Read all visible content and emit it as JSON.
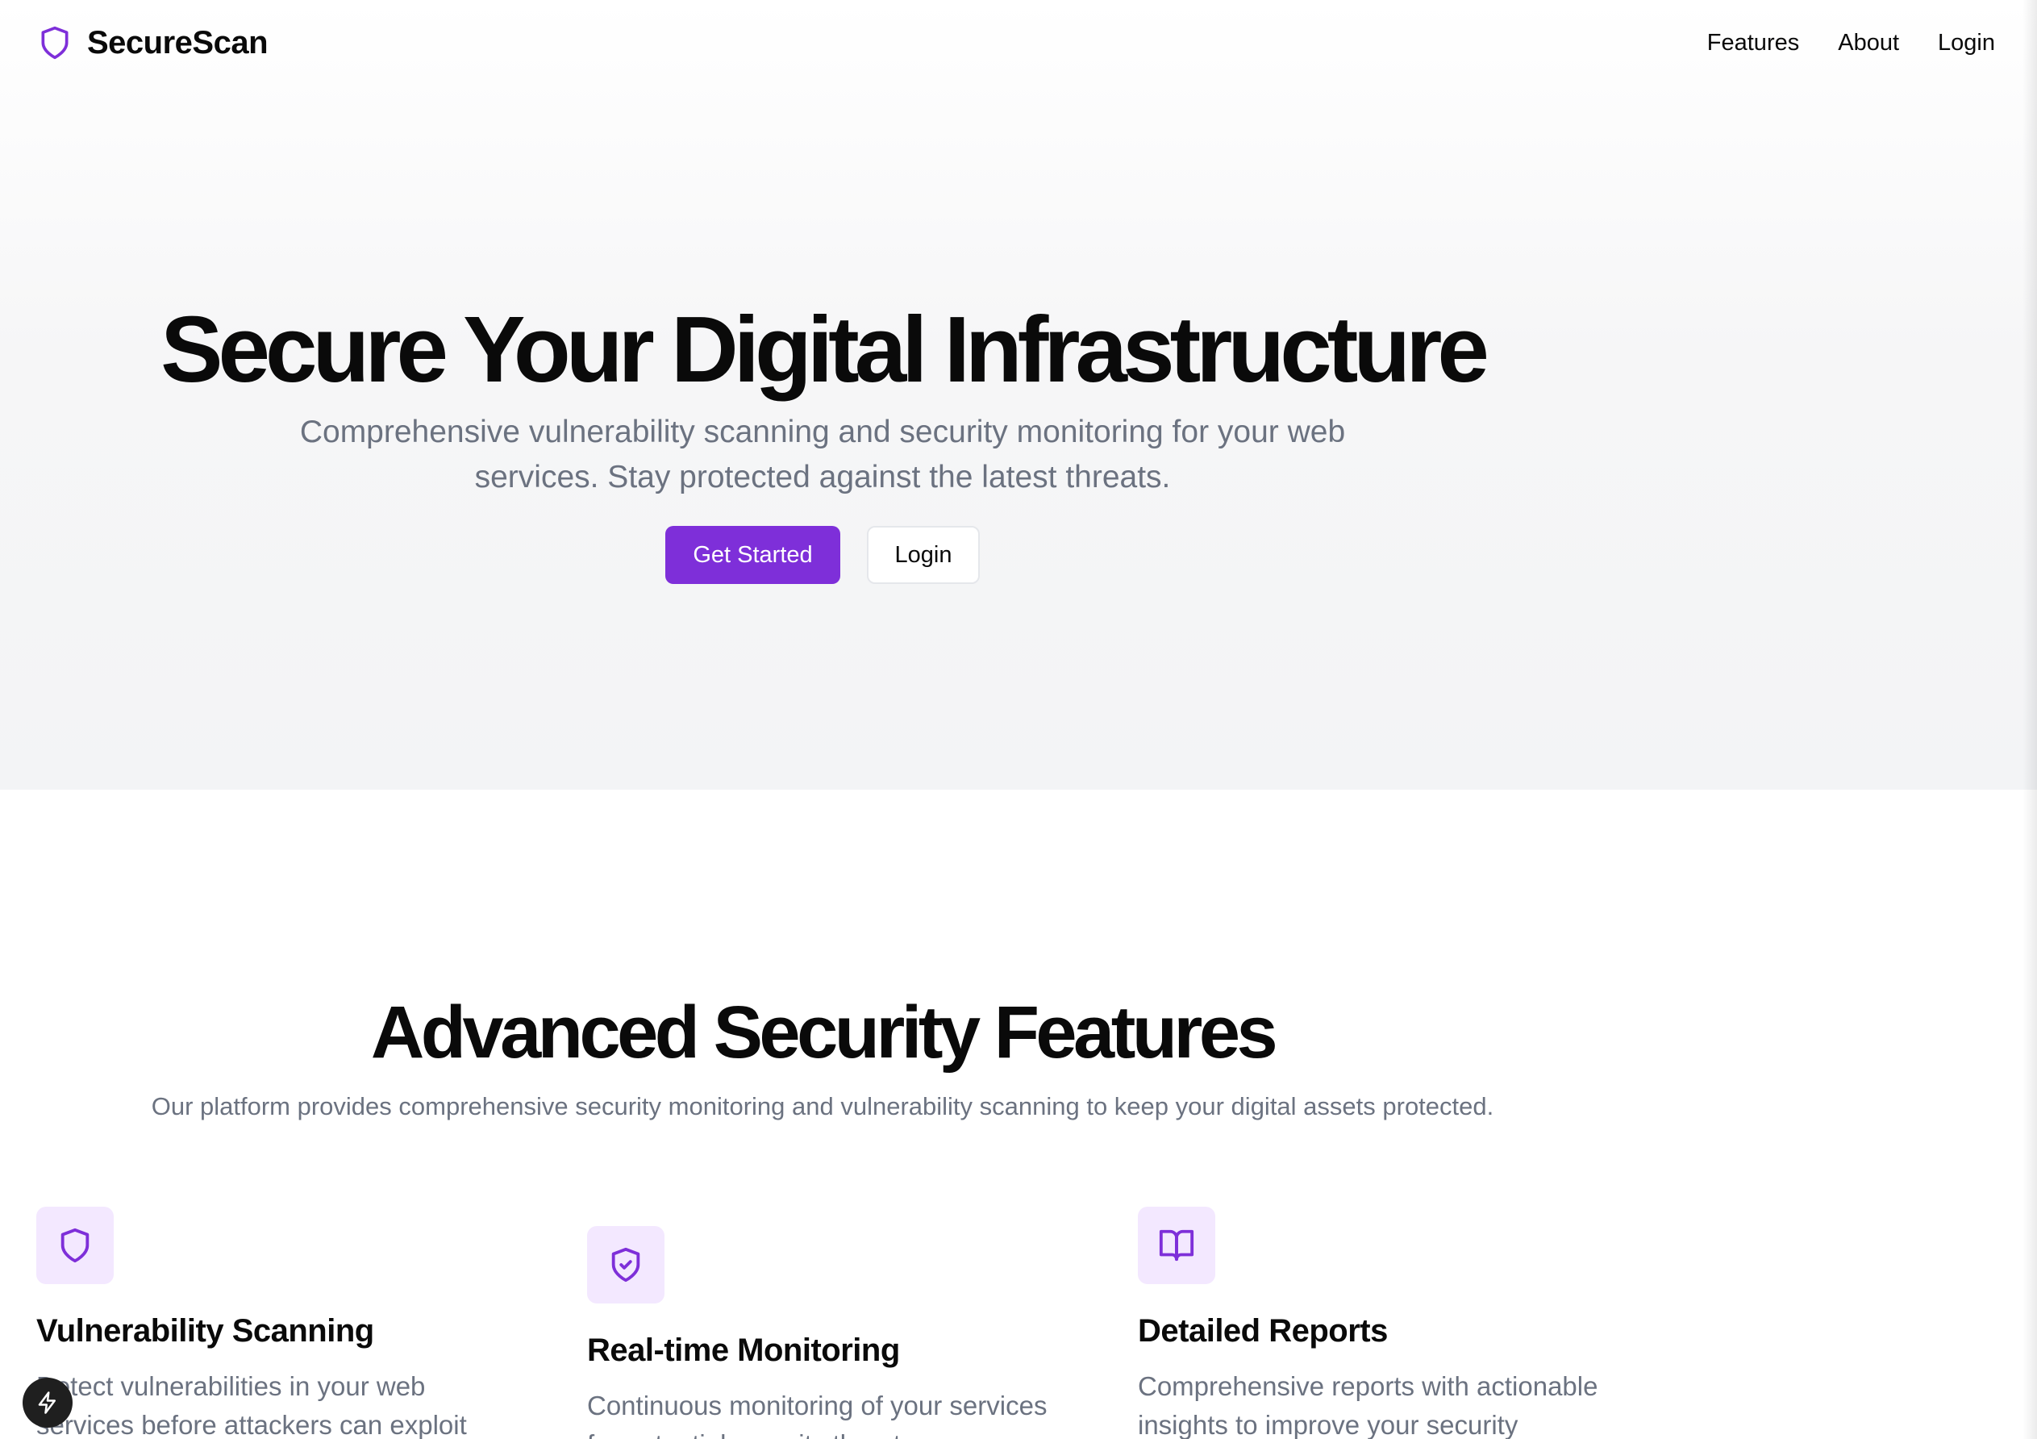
{
  "brand": {
    "name": "SecureScan",
    "icon": "shield-icon",
    "accent": "#7e2fd9"
  },
  "nav": {
    "features": "Features",
    "about": "About",
    "login": "Login"
  },
  "hero": {
    "title": "Secure Your Digital Infrastructure",
    "subtitle_line1": "Comprehensive vulnerability scanning and security monitoring for your web",
    "subtitle_line2": "services. Stay protected against the latest threats.",
    "primary_button": "Get Started",
    "secondary_button": "Login"
  },
  "features": {
    "title": "Advanced Security Features",
    "subtitle": "Our platform provides comprehensive security monitoring and vulnerability scanning to keep your digital assets protected.",
    "items": [
      {
        "icon": "shield-icon",
        "title": "Vulnerability Scanning",
        "desc_line1": "Detect vulnerabilities in your web",
        "desc_line2": "services before attackers can exploit"
      },
      {
        "icon": "shield-check-icon",
        "title": "Real-time Monitoring",
        "desc_line1": "Continuous monitoring of your services",
        "desc_line2": "for potential security threats"
      },
      {
        "icon": "book-open-icon",
        "title": "Detailed Reports",
        "desc_line1": "Comprehensive reports with actionable",
        "desc_line2": "insights to improve your security"
      }
    ]
  },
  "floating_button": {
    "icon": "lightning-icon"
  }
}
